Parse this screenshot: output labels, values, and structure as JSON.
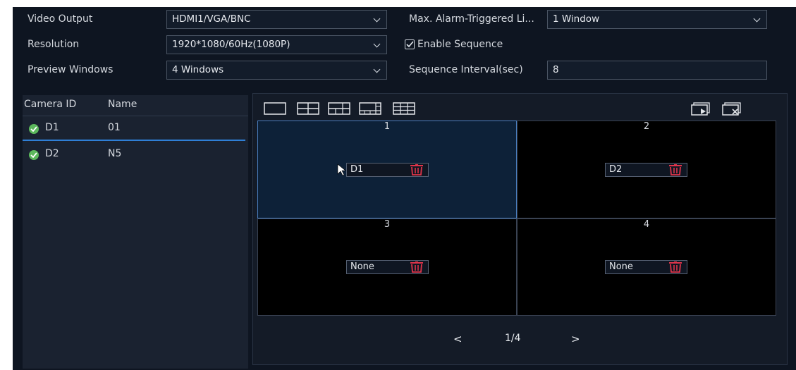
{
  "settings": {
    "video_output": {
      "label": "Video Output",
      "value": "HDMI1/VGA/BNC"
    },
    "resolution": {
      "label": "Resolution",
      "value": "1920*1080/60Hz(1080P)"
    },
    "preview_windows": {
      "label": "Preview Windows",
      "value": "4 Windows"
    },
    "max_alarm": {
      "label": "Max. Alarm-Triggered Li...",
      "value": "1 Window"
    },
    "enable_sequence": {
      "label": "Enable Sequence",
      "checked": true
    },
    "sequence_interval": {
      "label": "Sequence Interval(sec)",
      "value": "8"
    }
  },
  "camera_list": {
    "headers": {
      "id": "Camera ID",
      "name": "Name"
    },
    "rows": [
      {
        "id": "D1",
        "name": "01",
        "status": "online",
        "selected": true
      },
      {
        "id": "D2",
        "name": "N5",
        "status": "online",
        "selected": false
      }
    ]
  },
  "preview": {
    "layouts": [
      "single-window-icon",
      "four-window-icon",
      "six-window-icon",
      "eight-window-icon",
      "nine-window-icon"
    ],
    "sequence_controls": [
      "start-sequence-icon",
      "clear-sequence-icon"
    ],
    "windows": [
      {
        "number": "1",
        "channel": "D1",
        "active": true
      },
      {
        "number": "2",
        "channel": "D2",
        "active": false
      },
      {
        "number": "3",
        "channel": "None",
        "active": false
      },
      {
        "number": "4",
        "channel": "None",
        "active": false
      }
    ],
    "pager": {
      "prev": "<",
      "page": "1/4",
      "next": ">"
    }
  },
  "colors": {
    "background": "#0e1521",
    "accent": "#2f7fd6",
    "online": "#5cb85c",
    "delete": "#e0344a"
  }
}
